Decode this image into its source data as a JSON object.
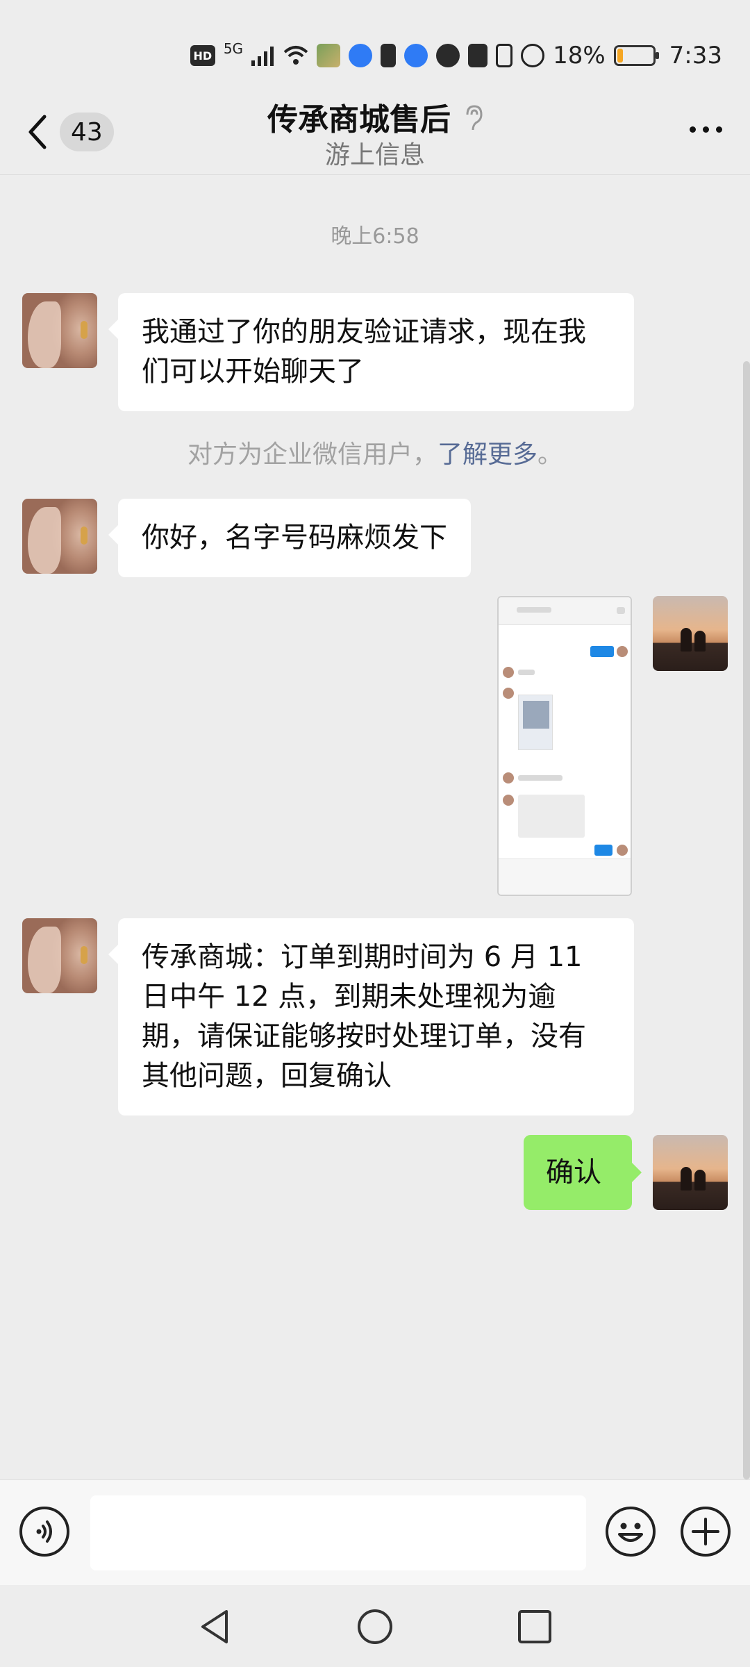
{
  "status_bar": {
    "battery_percent_text": "18%",
    "battery_level": 0.18,
    "time": "7:33",
    "network": "5G",
    "hd_label": "HD",
    "icons": [
      "hd-icon",
      "signal-icon",
      "wifi-icon",
      "photo-notification-icon",
      "shield-icon",
      "sim-icon",
      "browser-icon",
      "qq-icon",
      "nfc-icon",
      "vibrate-icon",
      "speedometer-icon",
      "battery-icon"
    ]
  },
  "header": {
    "unread_count": "43",
    "title": "传承商城售后",
    "subtitle": "游上信息",
    "icons": [
      "back-chevron-icon",
      "ear-icon",
      "more-dots-icon"
    ]
  },
  "chat": {
    "timestamp": "晚上6:58",
    "messages": [
      {
        "side": "left",
        "text": "我通过了你的朋友验证请求，现在我们可以开始聊天了"
      },
      {
        "side": "left",
        "text": "你好，名字号码麻烦发下"
      },
      {
        "side": "right",
        "type": "image"
      },
      {
        "side": "left",
        "text": "传承商城：订单到期时间为 6 月 11 日中午 12 点，到期未处理视为逾期，请保证能够按时处理订单，没有其他问题，回复确认"
      },
      {
        "side": "right",
        "text": "确认"
      }
    ],
    "system_note": {
      "text": "对方为企业微信用户，",
      "link": "了解更多",
      "suffix": "。"
    }
  },
  "input_bar": {
    "placeholder": "",
    "icons": [
      "voice-icon",
      "emoji-icon",
      "plus-icon"
    ]
  },
  "nav_bar": {
    "icons": [
      "back-triangle-icon",
      "home-circle-icon",
      "recents-square-icon"
    ]
  },
  "colors": {
    "background": "#ededed",
    "bubble_incoming": "#ffffff",
    "bubble_outgoing": "#95ec69",
    "link": "#576b95",
    "battery_fill": "#f5a623"
  }
}
